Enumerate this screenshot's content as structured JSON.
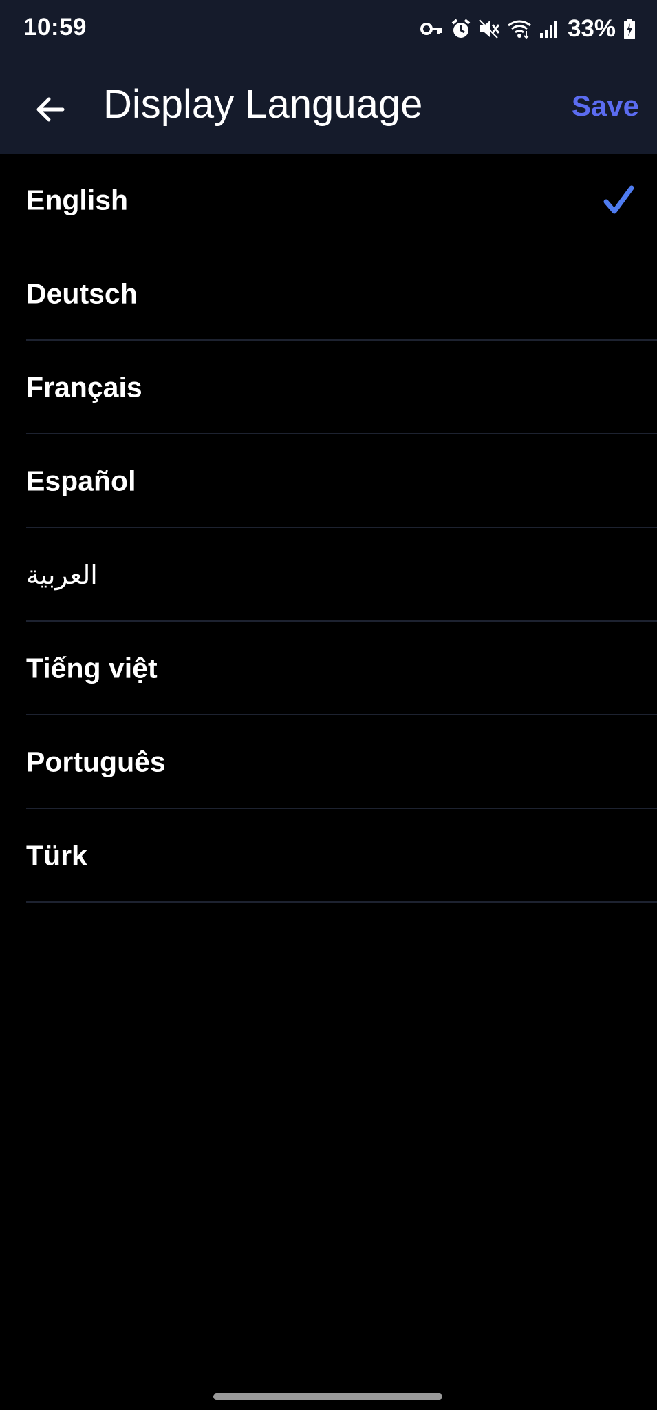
{
  "status_bar": {
    "time": "10:59",
    "battery_percent": "33%",
    "icons": [
      "vpn-key-icon",
      "alarm-icon",
      "mute-icon",
      "wifi-icon",
      "signal-icon",
      "battery-charging-icon"
    ]
  },
  "app_bar": {
    "back_icon": "arrow-left-icon",
    "title": "Display Language",
    "save_label": "Save"
  },
  "languages": [
    {
      "label": "English",
      "selected": true
    },
    {
      "label": "Deutsch",
      "selected": false
    },
    {
      "label": "Français",
      "selected": false
    },
    {
      "label": "Español",
      "selected": false
    },
    {
      "label": "العربية",
      "selected": false
    },
    {
      "label": "Tiếng việt",
      "selected": false
    },
    {
      "label": "Português",
      "selected": false
    },
    {
      "label": "Türk",
      "selected": false
    }
  ],
  "colors": {
    "header_bg": "#151b2b",
    "background": "#000000",
    "accent": "#5b6cf0",
    "check": "#4f7cf0"
  }
}
